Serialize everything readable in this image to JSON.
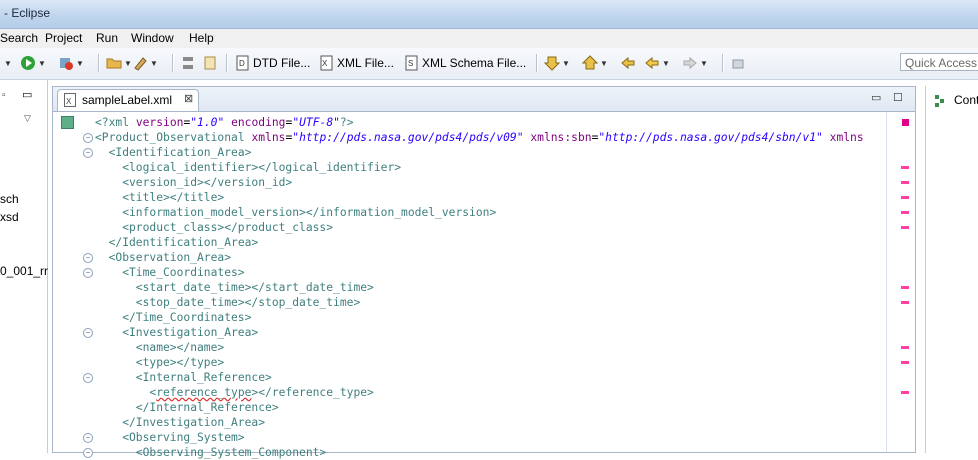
{
  "window": {
    "title": "- Eclipse"
  },
  "menu": [
    "Search",
    "Project",
    "Run",
    "Window",
    "Help"
  ],
  "toolbar": {
    "dtd_label": "DTD File...",
    "xml_label": "XML File...",
    "schema_label": "XML Schema File...",
    "quick_access_placeholder": "Quick Access"
  },
  "left_panel": {
    "items": [
      "sch",
      "xsd",
      "0_001_rr"
    ]
  },
  "editor": {
    "tab_label": "sampleLabel.xml",
    "lines": [
      {
        "indent": 0,
        "kind": "pi",
        "text": "<?xml version=\"1.0\" encoding=\"UTF-8\"?>"
      },
      {
        "indent": 0,
        "kind": "open_ns",
        "tag": "Product_Observational",
        "ns": [
          {
            "attr": "xmlns",
            "value": "http://pds.nasa.gov/pds4/pds/v09"
          },
          {
            "attr": "xmlns:sbn",
            "value": "http://pds.nasa.gov/pds4/sbn/v1"
          },
          {
            "attr": "xmlns",
            "value": ""
          }
        ]
      },
      {
        "indent": 1,
        "kind": "tag",
        "text": "<Identification_Area>"
      },
      {
        "indent": 2,
        "kind": "tag",
        "text": "<logical_identifier></logical_identifier>"
      },
      {
        "indent": 2,
        "kind": "tag",
        "text": "<version_id></version_id>"
      },
      {
        "indent": 2,
        "kind": "tag",
        "text": "<title></title>"
      },
      {
        "indent": 2,
        "kind": "tag",
        "text": "<information_model_version></information_model_version>"
      },
      {
        "indent": 2,
        "kind": "tag",
        "text": "<product_class></product_class>"
      },
      {
        "indent": 1,
        "kind": "tag",
        "text": "</Identification_Area>"
      },
      {
        "indent": 1,
        "kind": "tag",
        "text": "<Observation_Area>"
      },
      {
        "indent": 2,
        "kind": "tag",
        "text": "<Time_Coordinates>"
      },
      {
        "indent": 3,
        "kind": "tag",
        "text": "<start_date_time></start_date_time>"
      },
      {
        "indent": 3,
        "kind": "tag",
        "text": "<stop_date_time></stop_date_time>"
      },
      {
        "indent": 2,
        "kind": "tag",
        "text": "</Time_Coordinates>"
      },
      {
        "indent": 2,
        "kind": "tag",
        "text": "<Investigation_Area>"
      },
      {
        "indent": 3,
        "kind": "tag",
        "text": "<name></name>"
      },
      {
        "indent": 3,
        "kind": "tag",
        "text": "<type></type>"
      },
      {
        "indent": 3,
        "kind": "tag",
        "text": "<Internal_Reference>"
      },
      {
        "indent": 4,
        "kind": "err",
        "text": "<reference_type></reference_type>"
      },
      {
        "indent": 3,
        "kind": "tag",
        "text": "</Internal_Reference>"
      },
      {
        "indent": 2,
        "kind": "tag",
        "text": "</Investigation_Area>"
      },
      {
        "indent": 2,
        "kind": "tag",
        "text": "<Observing_System>"
      },
      {
        "indent": 3,
        "kind": "tag",
        "text": "<Observing_System_Component>"
      }
    ],
    "fold_lines": [
      1,
      2,
      9,
      10,
      14,
      17,
      21,
      22
    ],
    "overview_marks": [
      3,
      4,
      5,
      6,
      7,
      11,
      12,
      15,
      16,
      18
    ]
  },
  "right_panel": {
    "label": "Conte"
  },
  "colors": {
    "tag": "#3f7f7f",
    "attr": "#7f007f",
    "value": "#2a00ff",
    "mark": "#ff3fa6"
  }
}
